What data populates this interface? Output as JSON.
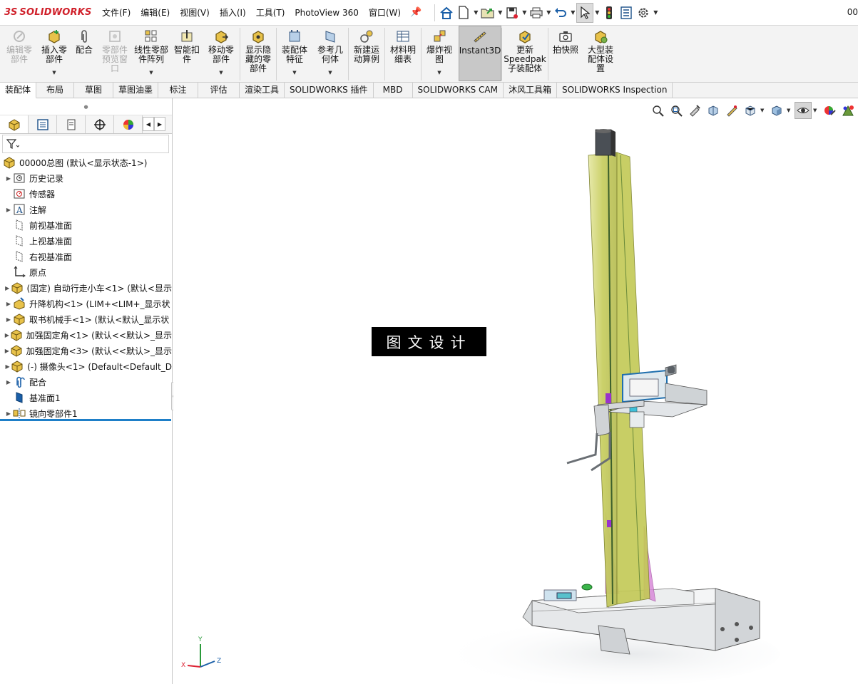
{
  "app": {
    "logo_prefix": "3S",
    "logo_text": "SOLIDWORKS",
    "document_name_fragment": "00"
  },
  "menu": [
    {
      "label": "文件(F)"
    },
    {
      "label": "编辑(E)"
    },
    {
      "label": "视图(V)"
    },
    {
      "label": "插入(I)"
    },
    {
      "label": "工具(T)"
    },
    {
      "label": "PhotoView 360"
    },
    {
      "label": "窗口(W)"
    }
  ],
  "quick_access": [
    {
      "icon": "home-icon"
    },
    {
      "icon": "new-document-icon"
    },
    {
      "icon": "open-folder-icon"
    },
    {
      "icon": "save-icon"
    },
    {
      "icon": "print-icon"
    },
    {
      "icon": "undo-icon"
    },
    {
      "icon": "select-cursor-icon"
    },
    {
      "icon": "rebuild-traffic-light-icon"
    },
    {
      "icon": "file-properties-icon"
    },
    {
      "icon": "options-gear-icon"
    }
  ],
  "ribbon": {
    "buttons": [
      {
        "label": "编辑零\n部件",
        "icon": "edit-component-icon",
        "disabled": true
      },
      {
        "label": "插入零\n部件",
        "icon": "insert-component-icon",
        "dropdown": true
      },
      {
        "label": "配合",
        "icon": "mate-paperclip-icon"
      },
      {
        "label": "零部件\n预览窗\n口",
        "icon": "component-preview-icon",
        "disabled": true
      },
      {
        "label": "线性零部\n件阵列",
        "icon": "linear-pattern-icon",
        "dropdown": true
      },
      {
        "label": "智能扣\n件",
        "icon": "smart-fasteners-icon"
      },
      {
        "label": "移动零\n部件",
        "icon": "move-component-icon",
        "dropdown": true
      },
      {
        "label": "显示隐\n藏的零\n部件",
        "icon": "show-hidden-components-icon"
      },
      {
        "label": "装配体\n特征",
        "icon": "assembly-features-icon",
        "dropdown": true
      },
      {
        "label": "参考几\n何体",
        "icon": "reference-geometry-icon",
        "dropdown": true
      },
      {
        "label": "新建运\n动算例",
        "icon": "new-motion-study-icon"
      },
      {
        "label": "材料明\n细表",
        "icon": "bill-of-materials-icon"
      },
      {
        "label": "爆炸视\n图",
        "icon": "exploded-view-icon",
        "dropdown": true
      },
      {
        "label": "Instant3D",
        "icon": "instant3d-icon",
        "toggled": true
      },
      {
        "label": "更新\nSpeedpak\n子装配体",
        "icon": "update-speedpak-icon"
      },
      {
        "label": "拍快照",
        "icon": "snapshot-camera-icon"
      },
      {
        "label": "大型装\n配体设\n置",
        "icon": "large-assembly-settings-icon"
      }
    ]
  },
  "tabs": [
    {
      "label": "装配体",
      "active": true
    },
    {
      "label": "布局"
    },
    {
      "label": "草图"
    },
    {
      "label": "草图油墨"
    },
    {
      "label": "标注"
    },
    {
      "label": "评估"
    },
    {
      "label": "渲染工具"
    },
    {
      "label": "SOLIDWORKS 插件"
    },
    {
      "label": "MBD"
    },
    {
      "label": "SOLIDWORKS CAM"
    },
    {
      "label": "沐风工具箱"
    },
    {
      "label": "SOLIDWORKS Inspection"
    }
  ],
  "panel_tabs": [
    {
      "icon": "featuremanager-tree-icon",
      "active": true
    },
    {
      "icon": "property-manager-icon"
    },
    {
      "icon": "configuration-manager-icon"
    },
    {
      "icon": "dimxpert-icon"
    },
    {
      "icon": "display-manager-icon"
    }
  ],
  "feature_tree": {
    "root": {
      "label": "00000总图  (默认<显示状态-1>)",
      "icon": "assembly-icon"
    },
    "items": [
      {
        "label": "历史记录",
        "icon": "history-icon",
        "expandable": true
      },
      {
        "label": "传感器",
        "icon": "sensor-icon",
        "expandable": false
      },
      {
        "label": "注解",
        "icon": "annotations-icon",
        "expandable": true
      },
      {
        "label": "前视基准面",
        "icon": "plane-icon",
        "expandable": false
      },
      {
        "label": "上视基准面",
        "icon": "plane-icon",
        "expandable": false
      },
      {
        "label": "右视基准面",
        "icon": "plane-icon",
        "expandable": false
      },
      {
        "label": "原点",
        "icon": "origin-icon",
        "expandable": false
      },
      {
        "label": "(固定) 自动行走小车<1> (默认<显示",
        "icon": "subassembly-icon",
        "expandable": true
      },
      {
        "label": "升降机构<1> (LIM+<LIM+_显示状",
        "icon": "flexible-subassembly-icon",
        "expandable": true
      },
      {
        "label": "取书机械手<1> (默认<默认_显示状",
        "icon": "subassembly-icon",
        "expandable": true
      },
      {
        "label": "加强固定角<1> (默认<<默认>_显示",
        "icon": "subassembly-icon",
        "expandable": true
      },
      {
        "label": "加强固定角<3> (默认<<默认>_显示",
        "icon": "subassembly-icon",
        "expandable": true
      },
      {
        "label": "(-) 摄像头<1> (Default<Default_D",
        "icon": "subassembly-icon",
        "expandable": true
      },
      {
        "label": "配合",
        "icon": "mates-icon",
        "expandable": true
      },
      {
        "label": "基准面1",
        "icon": "plane-solid-icon",
        "expandable": false
      },
      {
        "label": "镜向零部件1",
        "icon": "mirror-components-icon",
        "expandable": true
      }
    ]
  },
  "heads_up_toolbar": [
    {
      "icon": "zoom-to-fit-icon"
    },
    {
      "icon": "zoom-to-area-icon"
    },
    {
      "icon": "previous-view-icon"
    },
    {
      "icon": "section-view-icon"
    },
    {
      "icon": "dynamic-annotation-icon"
    },
    {
      "icon": "view-orientation-icon",
      "dropdown": true
    },
    {
      "icon": "display-style-icon",
      "dropdown": true
    },
    {
      "icon": "hide-show-items-icon",
      "dropdown": true,
      "active": true
    },
    {
      "icon": "edit-appearance-icon"
    },
    {
      "icon": "apply-scene-icon"
    }
  ],
  "viewport": {
    "watermark": "图文设计",
    "triad_labels": {
      "x": "X",
      "y": "Y",
      "z": "Z"
    }
  },
  "colors": {
    "brand_red": "#d0202a",
    "selection_blue": "#1e7fc8",
    "column_yellow": "#d9de7a",
    "bracket_pink": "#d98ad9",
    "body_gray": "#e6e8ea"
  }
}
